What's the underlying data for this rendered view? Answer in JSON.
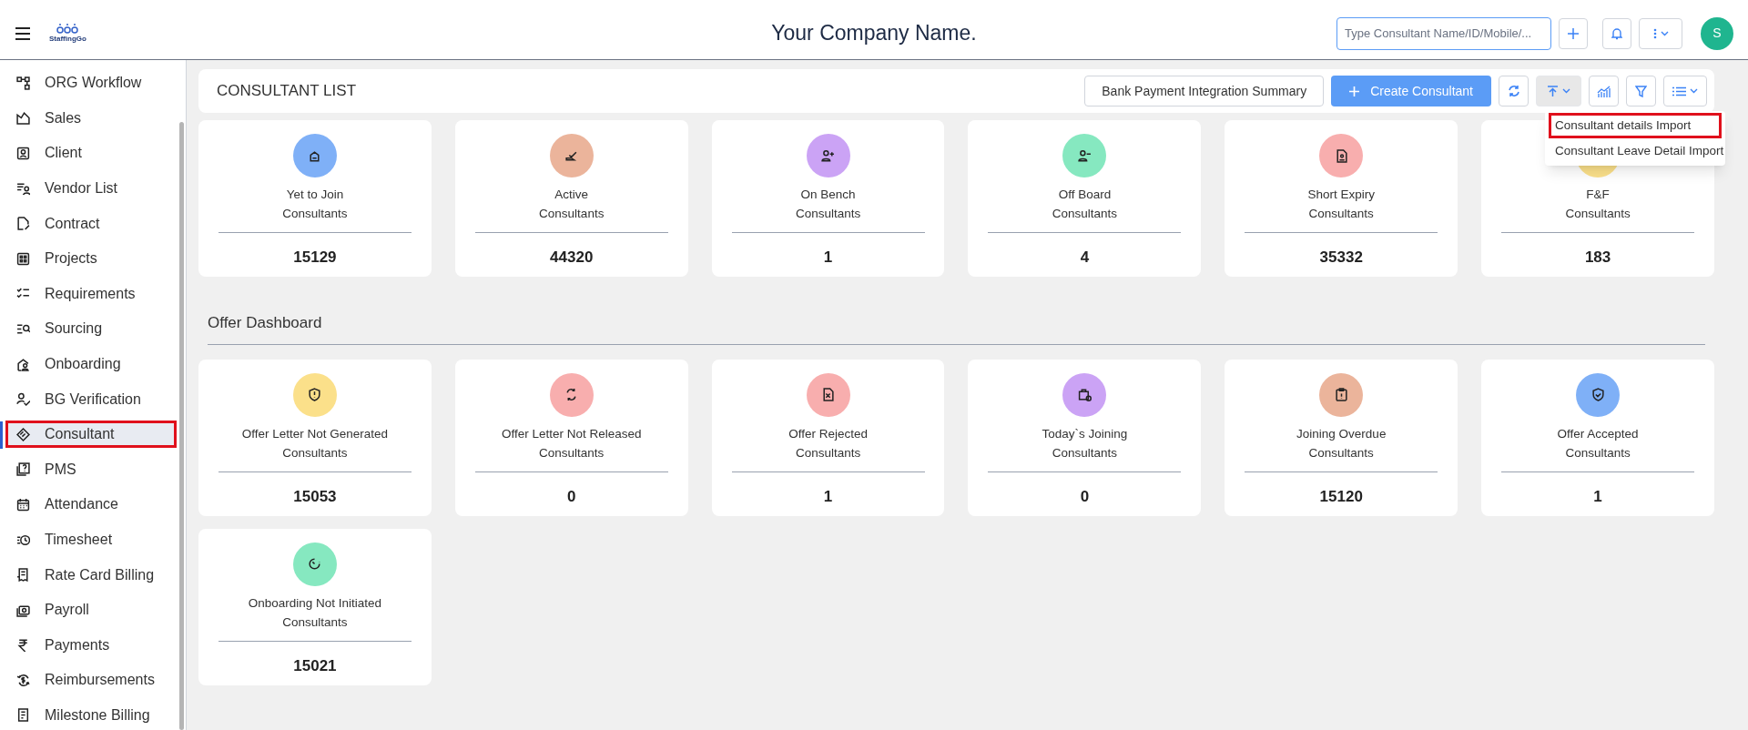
{
  "header": {
    "logo_text": "StaffingGo",
    "title": "Your Company Name.",
    "search": {
      "placeholder": "Type Consultant Name/ID/Mobile/..."
    },
    "avatar": "S"
  },
  "sidebar": {
    "items": [
      {
        "label": "ORG Workflow",
        "selected": false,
        "highlighted": false
      },
      {
        "label": "Sales",
        "selected": false,
        "highlighted": false
      },
      {
        "label": "Client",
        "selected": false,
        "highlighted": false
      },
      {
        "label": "Vendor List",
        "selected": false,
        "highlighted": false
      },
      {
        "label": "Contract",
        "selected": false,
        "highlighted": false
      },
      {
        "label": "Projects",
        "selected": false,
        "highlighted": false
      },
      {
        "label": "Requirements",
        "selected": false,
        "highlighted": false
      },
      {
        "label": "Sourcing",
        "selected": false,
        "highlighted": false
      },
      {
        "label": "Onboarding",
        "selected": false,
        "highlighted": false
      },
      {
        "label": "BG Verification",
        "selected": false,
        "highlighted": false
      },
      {
        "label": "Consultant",
        "selected": true,
        "highlighted": true
      },
      {
        "label": "PMS",
        "selected": false,
        "highlighted": false
      },
      {
        "label": "Attendance",
        "selected": false,
        "highlighted": false
      },
      {
        "label": "Timesheet",
        "selected": false,
        "highlighted": false
      },
      {
        "label": "Rate Card Billing",
        "selected": false,
        "highlighted": false
      },
      {
        "label": "Payroll",
        "selected": false,
        "highlighted": false
      },
      {
        "label": "Payments",
        "selected": false,
        "highlighted": false
      },
      {
        "label": "Reimbursements",
        "selected": false,
        "highlighted": false
      },
      {
        "label": "Milestone Billing",
        "selected": false,
        "highlighted": false
      }
    ]
  },
  "toolbar": {
    "title": "CONSULTANT LIST",
    "summary_button": "Bank Payment Integration Summary",
    "create_button": "Create Consultant",
    "import_menu": {
      "expanded": true,
      "items": [
        {
          "label": "Consultant details Import",
          "highlighted": true
        },
        {
          "label": "Consultant Leave Detail Import",
          "highlighted": false
        }
      ]
    }
  },
  "consultant_cards": [
    {
      "label": "Yet to Join",
      "sub": "Consultants",
      "count": "15129",
      "color": "#7fb0f7"
    },
    {
      "label": "Active",
      "sub": "Consultants",
      "count": "44320",
      "color": "#ebb49b"
    },
    {
      "label": "On Bench",
      "sub": "Consultants",
      "count": "1",
      "color": "#cba3f5"
    },
    {
      "label": "Off Board",
      "sub": "Consultants",
      "count": "4",
      "color": "#86e8c0"
    },
    {
      "label": "Short Expiry",
      "sub": "Consultants",
      "count": "35332",
      "color": "#f8aeae"
    },
    {
      "label": "F&F",
      "sub": "Consultants",
      "count": "183",
      "color": "#fbe08a"
    }
  ],
  "offer_dashboard": {
    "title": "Offer Dashboard",
    "cards": [
      {
        "label": "Offer Letter Not Generated",
        "sub": "Consultants",
        "count": "15053",
        "color": "#fbe08a"
      },
      {
        "label": "Offer Letter Not Released",
        "sub": "Consultants",
        "count": "0",
        "color": "#f8aeae"
      },
      {
        "label": "Offer Rejected",
        "sub": "Consultants",
        "count": "1",
        "color": "#f8aeae"
      },
      {
        "label": "Today`s Joining",
        "sub": "Consultants",
        "count": "0",
        "color": "#cba3f5"
      },
      {
        "label": "Joining Overdue",
        "sub": "Consultants",
        "count": "15120",
        "color": "#ebb49b"
      },
      {
        "label": "Offer Accepted",
        "sub": "Consultants",
        "count": "1",
        "color": "#7fb0f7"
      },
      {
        "label": "Onboarding Not Initiated",
        "sub": "Consultants",
        "count": "15021",
        "color": "#86e8c0"
      }
    ]
  }
}
